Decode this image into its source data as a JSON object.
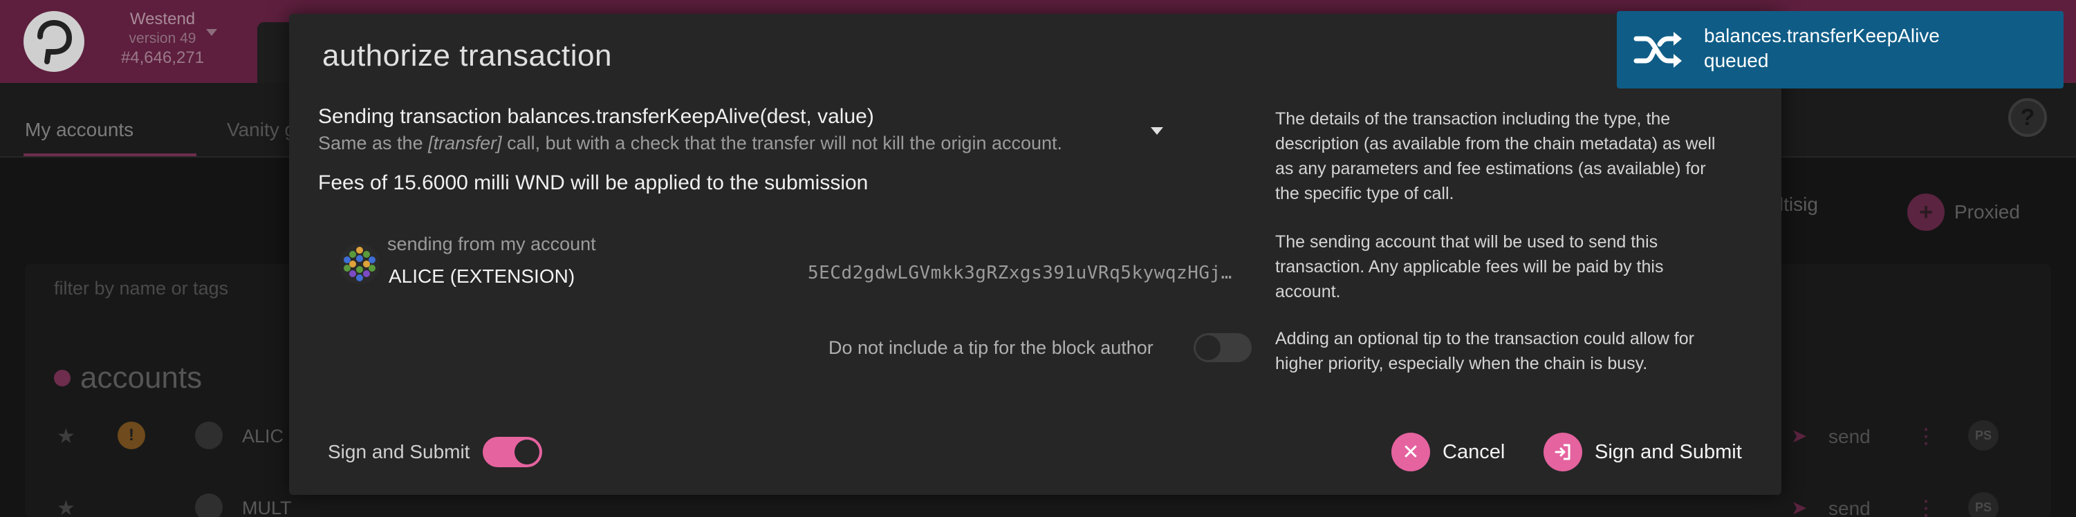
{
  "app": {
    "chain_name": "Westend",
    "chain_version": "version 49",
    "block_number": "#4,646,271",
    "tabs": [
      {
        "label": "My accounts",
        "active": true
      },
      {
        "label": "Vanity g"
      }
    ],
    "actions": [
      {
        "label": "Multisig"
      },
      {
        "label": "Proxied"
      }
    ],
    "filter_placeholder": "filter by name or tags",
    "accounts_heading": "accounts",
    "rows": [
      {
        "name": "ALIC",
        "send_label": "send",
        "badge": "PS"
      },
      {
        "name": "MULT",
        "send_label": "send",
        "badge": "PS"
      }
    ]
  },
  "modal": {
    "title": "authorize transaction",
    "transaction": {
      "title": "Sending transaction balances.transferKeepAlive(dest, value)",
      "description_prefix": "Same as the ",
      "description_ref": "[transfer]",
      "description_suffix": " call, but with a check that the transfer will not kill the origin account.",
      "fees": "Fees of 15.6000 milli WND will be applied to the submission"
    },
    "sender": {
      "label": "sending from my account",
      "name": "ALICE (EXTENSION)",
      "address": "5ECd2gdwLGVmkk3gRZxgs391uVRq5kywqzHGj…"
    },
    "tip": {
      "label": "Do not include a tip for the block author",
      "enabled": false
    },
    "help": [
      "The details of the transaction including the type, the description (as available from the chain metadata) as well as any parameters and fee estimations (as available) for the specific type of call.",
      "The sending account that will be used to send this transaction. Any applicable fees will be paid by this account.",
      "Adding an optional tip to the transaction could allow for higher priority, especially when the chain is busy."
    ],
    "sign_and_submit_toggle": {
      "label": "Sign and Submit",
      "enabled": true
    },
    "buttons": {
      "cancel": "Cancel",
      "submit": "Sign and Submit"
    }
  },
  "toast": {
    "title": "balances.transferKeepAlive",
    "status": "queued",
    "icon": "shuffle-icon",
    "color": "#0f5d87"
  },
  "colors": {
    "accent": "#e5639f",
    "modal_bg": "#262626",
    "topbar": "#5e1f3e"
  }
}
